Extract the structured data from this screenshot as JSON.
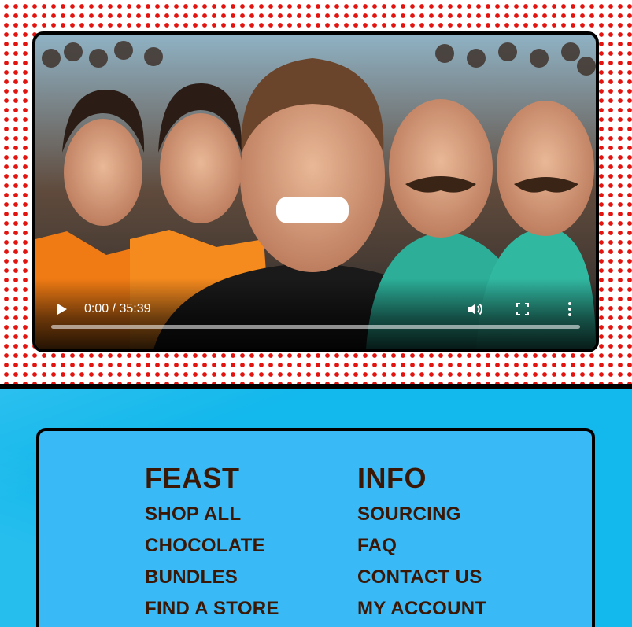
{
  "video": {
    "current_time": "0:00",
    "separator": "/",
    "duration": "35:39",
    "time_display": "0:00 / 35:39",
    "progress": 0,
    "icons": [
      "play-icon",
      "volume-icon",
      "fullscreen-icon",
      "more-options-icon"
    ]
  },
  "footer": {
    "feast": {
      "title": "FEAST",
      "links": [
        "SHOP ALL",
        "CHOCOLATE",
        "BUNDLES",
        "FIND A STORE"
      ]
    },
    "info": {
      "title": "INFO",
      "links": [
        "SOURCING",
        "FAQ",
        "CONTACT US",
        "MY ACCOUNT"
      ]
    }
  },
  "colors": {
    "dot_red": "#e3130f",
    "band_blue": "#13b8ec",
    "card_blue": "#39baf7",
    "text_brown": "#3b1706"
  }
}
